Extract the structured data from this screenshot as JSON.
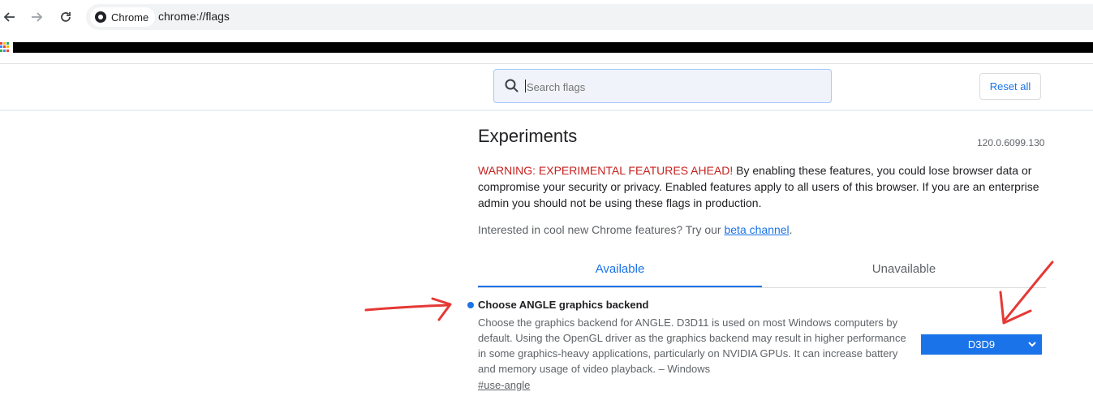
{
  "browser": {
    "chip_label": "Chrome",
    "url": "chrome://flags"
  },
  "header": {
    "search_placeholder": "Search flags",
    "reset_label": "Reset all"
  },
  "main": {
    "title": "Experiments",
    "version": "120.0.6099.130",
    "warning_prefix": "WARNING: EXPERIMENTAL FEATURES AHEAD!",
    "warning_body": " By enabling these features, you could lose browser data or compromise your security or privacy. Enabled features apply to all users of this browser. If you are an enterprise admin you should not be using these flags in production.",
    "interest_text": "Interested in cool new Chrome features? Try our ",
    "interest_link": "beta channel",
    "interest_end": "."
  },
  "tabs": [
    {
      "label": "Available"
    },
    {
      "label": "Unavailable"
    }
  ],
  "flag": {
    "title": "Choose ANGLE graphics backend",
    "description": "Choose the graphics backend for ANGLE. D3D11 is used on most Windows computers by default. Using the OpenGL driver as the graphics backend may result in higher performance in some graphics-heavy applications, particularly on NVIDIA GPUs. It can increase battery and memory usage of video playback. – Windows",
    "link": "#use-angle",
    "selected_value": "D3D9"
  },
  "colors": {
    "accent": "#1a73e8",
    "warning": "#c5221f",
    "annotation": "#e53935"
  }
}
